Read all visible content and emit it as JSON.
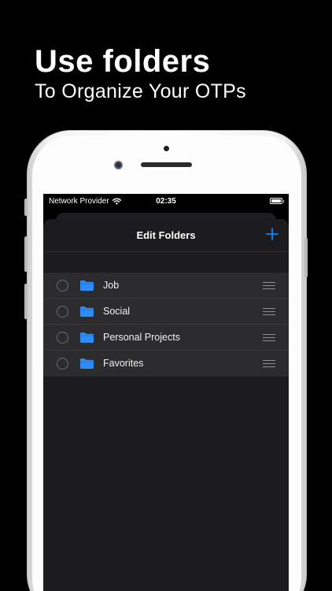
{
  "promo": {
    "headline": "Use folders",
    "subline": "To Organize Your OTPs"
  },
  "status_bar": {
    "carrier": "Network Provider",
    "time": "02:35",
    "battery_level": 1.0
  },
  "sheet": {
    "title": "Edit Folders",
    "add_icon": "plus-icon"
  },
  "folders": [
    {
      "label": "Job"
    },
    {
      "label": "Social"
    },
    {
      "label": "Personal Projects"
    },
    {
      "label": "Favorites"
    }
  ],
  "colors": {
    "accent": "#0a84ff",
    "folder": "#2f8cf5",
    "sheet_bg": "#1c1c1e",
    "row_bg": "#2c2c2e"
  }
}
